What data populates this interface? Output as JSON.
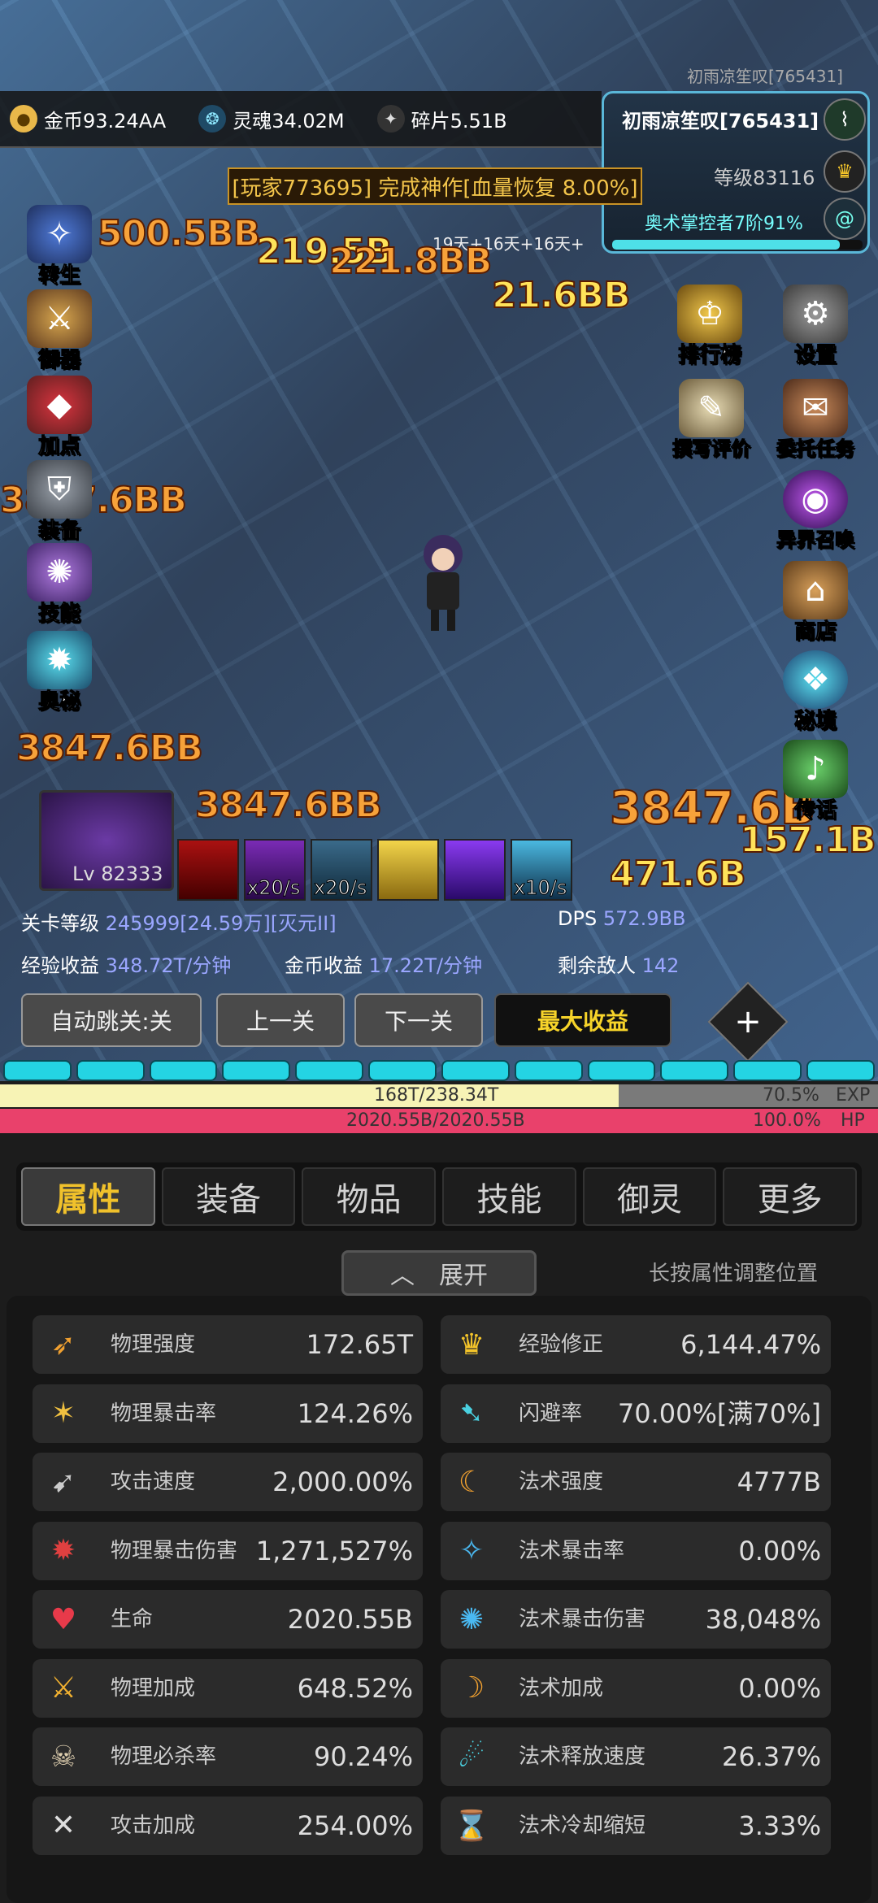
{
  "top": {
    "faded_player": "初雨凉笙叹[765431]",
    "resources": [
      {
        "icon": "gold-coin-icon",
        "label": "金币93.24AA"
      },
      {
        "icon": "soul-icon",
        "label": "灵魂34.02M"
      },
      {
        "icon": "shard-icon",
        "label": "碎片5.51B"
      }
    ],
    "player": {
      "name": "初雨凉笙叹[765431]",
      "level": "等级83116",
      "arcana": "奥术掌控者7阶91%",
      "arcana_progress": 0.91
    },
    "banner": "[玩家773695] 完成神作[血量恢复 8.00%]",
    "timer": "19天+16天+16天+"
  },
  "left_menu": [
    {
      "icon": "rebirth-icon",
      "label": "转生"
    },
    {
      "icon": "artifact-icon",
      "label": "御器"
    },
    {
      "icon": "attribute-point-icon",
      "label": "加点"
    },
    {
      "icon": "equipment-icon",
      "label": "装备"
    },
    {
      "icon": "skill-scroll-icon",
      "label": "技能"
    },
    {
      "icon": "arcane-icon",
      "label": "奥秘"
    }
  ],
  "right_menu": [
    {
      "icon": "leaderboard-icon",
      "label": "排行榜"
    },
    {
      "icon": "settings-icon",
      "label": "设置"
    },
    {
      "icon": "review-scroll-icon",
      "label": "撰写评价"
    },
    {
      "icon": "commission-icon",
      "label": "委托任务"
    },
    {
      "icon": "summon-portal-icon",
      "label": "异界召唤"
    },
    {
      "icon": "shop-icon",
      "label": "商店"
    },
    {
      "icon": "secret-realm-icon",
      "label": "秘境"
    },
    {
      "icon": "teleport-horn-icon",
      "label": "传话"
    }
  ],
  "damage_numbers": [
    "500.5BB",
    "219.5B",
    "221.8BB",
    "21.6BB",
    "3847.6BB",
    "3847.6B",
    "157.1B",
    "471.6B",
    "3847.6BB",
    "3847.6BB"
  ],
  "pet": {
    "level": "Lv 82333"
  },
  "skills": [
    {
      "rate": ""
    },
    {
      "rate": "x20/s"
    },
    {
      "rate": "x20/s"
    },
    {
      "rate": ""
    },
    {
      "rate": ""
    },
    {
      "rate": "x10/s"
    }
  ],
  "stage": {
    "level_label": "关卡等级",
    "level_value": "245999[24.59万][灭元II]",
    "dps_label": "DPS",
    "dps_value": "572.9BB",
    "exp_label": "经验收益",
    "exp_value": "348.72T/分钟",
    "gold_label": "金币收益",
    "gold_value": "17.22T/分钟",
    "enemies_label": "剩余敌人",
    "enemies_value": "142"
  },
  "buttons": {
    "auto": "自动跳关:关",
    "prev": "上一关",
    "next": "下一关",
    "max": "最大收益",
    "plus": "+"
  },
  "bars": {
    "exp_text": "168T/238.34T",
    "exp_pct": "70.5%",
    "exp_tag": "EXP",
    "exp_ratio": 0.705,
    "hp_text": "2020.55B/2020.55B",
    "hp_pct": "100.0%",
    "hp_tag": "HP",
    "hp_ratio": 1.0
  },
  "tabs": [
    "属性",
    "装备",
    "物品",
    "技能",
    "御灵",
    "更多"
  ],
  "expand": {
    "label": "展开",
    "hint": "长按属性调整位置"
  },
  "stats_left": [
    {
      "icon": "physical-power-icon",
      "name": "物理强度",
      "value": "172.65T"
    },
    {
      "icon": "physical-crit-icon",
      "name": "物理暴击率",
      "value": "124.26%"
    },
    {
      "icon": "attack-speed-icon",
      "name": "攻击速度",
      "value": "2,000.00%"
    },
    {
      "icon": "physical-crit-damage-icon",
      "name": "物理暴击伤害",
      "value": "1,271,527%"
    },
    {
      "icon": "heart-icon",
      "name": "生命",
      "value": "2020.55B"
    },
    {
      "icon": "physical-bonus-icon",
      "name": "物理加成",
      "value": "648.52%"
    },
    {
      "icon": "skull-icon",
      "name": "物理必杀率",
      "value": "90.24%"
    },
    {
      "icon": "crossed-swords-icon",
      "name": "攻击加成",
      "value": "254.00%"
    }
  ],
  "stats_right": [
    {
      "icon": "crown-icon",
      "name": "经验修正",
      "value": "6,144.47%"
    },
    {
      "icon": "dodge-icon",
      "name": "闪避率",
      "value": "70.00%[满70%]"
    },
    {
      "icon": "spell-power-icon",
      "name": "法术强度",
      "value": "4777B"
    },
    {
      "icon": "spell-crit-icon",
      "name": "法术暴击率",
      "value": "0.00%"
    },
    {
      "icon": "spell-crit-damage-icon",
      "name": "法术暴击伤害",
      "value": "38,048%"
    },
    {
      "icon": "spell-bonus-icon",
      "name": "法术加成",
      "value": "0.00%"
    },
    {
      "icon": "cast-speed-icon",
      "name": "法术释放速度",
      "value": "26.37%"
    },
    {
      "icon": "hourglass-icon",
      "name": "法术冷却缩短",
      "value": "3.33%"
    }
  ]
}
